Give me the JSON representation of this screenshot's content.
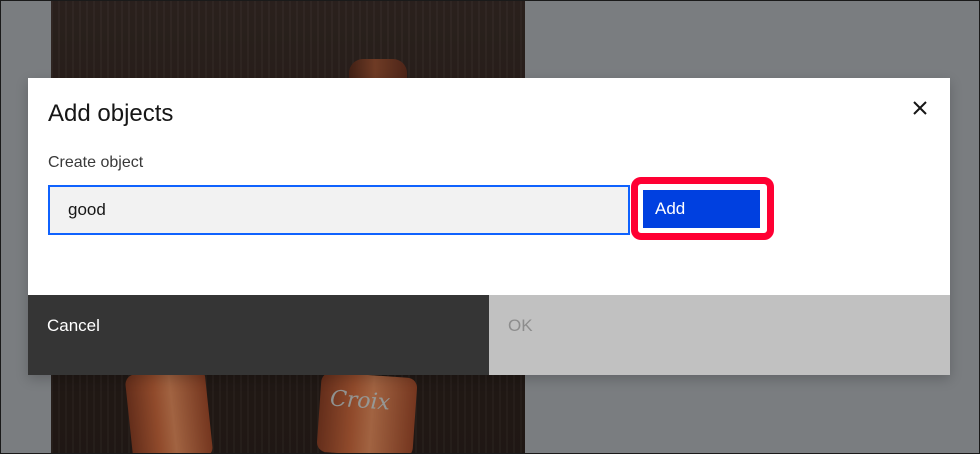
{
  "modal": {
    "title": "Add objects",
    "close_icon": "close-icon",
    "field_label": "Create object",
    "input_value": "good",
    "add_label": "Add",
    "cancel_label": "Cancel",
    "ok_label": "OK"
  },
  "background": {
    "can_text": "Croix"
  },
  "colors": {
    "primary_button": "#0040e0",
    "input_focus_border": "#0f62fe",
    "highlight_border": "#ff0033",
    "cancel_background": "#353535",
    "ok_disabled_background": "#c1c1c1",
    "overlay": "#7a7d80"
  }
}
